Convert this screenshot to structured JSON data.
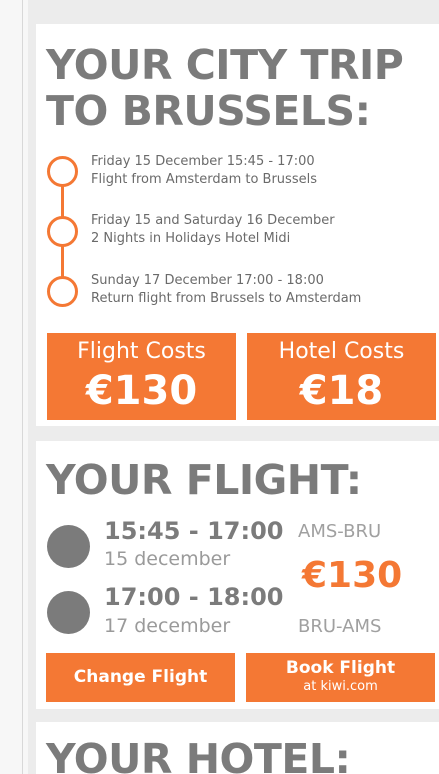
{
  "trip": {
    "title_line1": "YOUR CITY TRIP",
    "title_line2": "TO BRUSSELS:",
    "timeline": [
      {
        "line1": "Friday 15 December 15:45 - 17:00",
        "line2": "Flight from Amsterdam to Brussels"
      },
      {
        "line1": "Friday 15 and Saturday 16 December",
        "line2": "2 Nights in Holidays Hotel Midi"
      },
      {
        "line1": "Sunday 17 December 17:00 - 18:00",
        "line2": "Return flight from Brussels to Amsterdam"
      }
    ],
    "costs": {
      "flight_label": "Flight Costs",
      "flight_value": "€130",
      "hotel_label": "Hotel Costs",
      "hotel_value": "€18"
    }
  },
  "flight": {
    "title": "YOUR FLIGHT:",
    "outbound": {
      "time": "15:45 - 17:00",
      "date": "15 december",
      "route": "AMS-BRU"
    },
    "return": {
      "time": "17:00 - 18:00",
      "date": "17 december",
      "route": "BRU-AMS"
    },
    "price": "€130",
    "change_button": "Change Flight",
    "book_button": "Book Flight",
    "book_sub": "at kiwi.com"
  },
  "hotel": {
    "title": "YOUR HOTEL:"
  },
  "colors": {
    "accent": "#f47834",
    "heading": "#7b7b7b",
    "background": "#ececec"
  }
}
